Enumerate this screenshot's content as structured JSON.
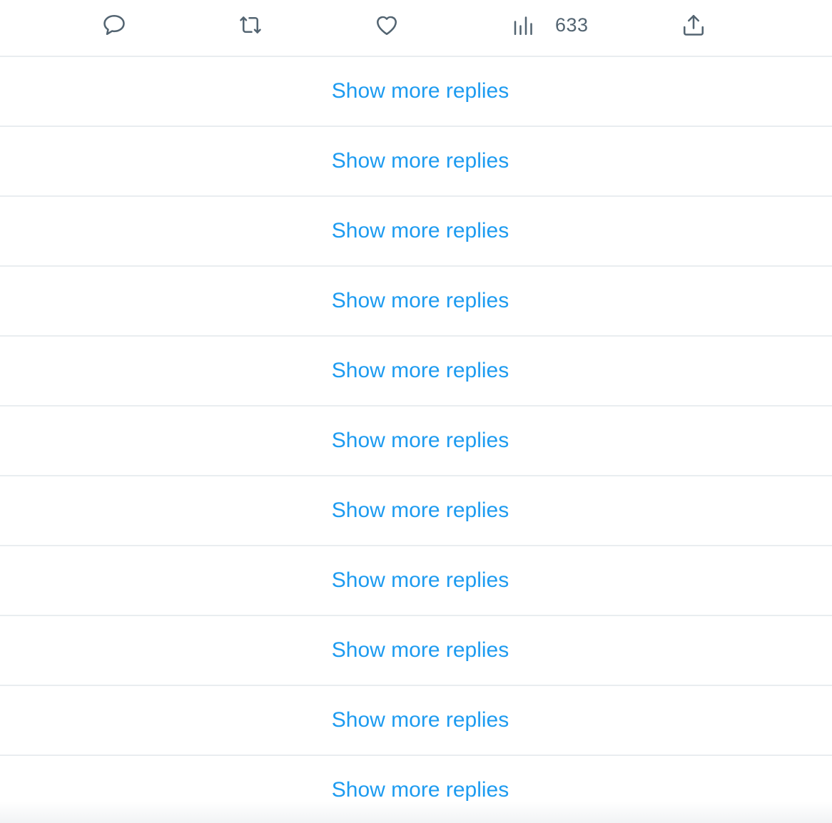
{
  "actions": {
    "reply_icon": "reply-icon",
    "retweet_icon": "retweet-icon",
    "like_icon": "heart-icon",
    "views_icon": "views-chart-icon",
    "views_count": "633",
    "share_icon": "share-upload-icon"
  },
  "colors": {
    "link": "#1d9bf0",
    "icon": "#536471",
    "divider": "#e9edf0"
  },
  "replies": [
    {
      "label": "Show more replies"
    },
    {
      "label": "Show more replies"
    },
    {
      "label": "Show more replies"
    },
    {
      "label": "Show more replies"
    },
    {
      "label": "Show more replies"
    },
    {
      "label": "Show more replies"
    },
    {
      "label": "Show more replies"
    },
    {
      "label": "Show more replies"
    },
    {
      "label": "Show more replies"
    },
    {
      "label": "Show more replies"
    },
    {
      "label": "Show more replies"
    }
  ]
}
